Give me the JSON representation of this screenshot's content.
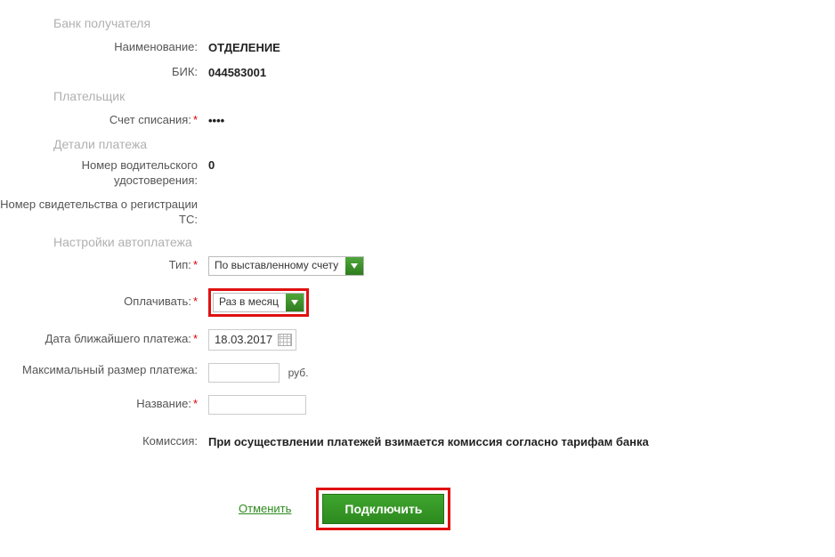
{
  "sections": {
    "recipient_bank": "Банк получателя",
    "payer": "Плательщик",
    "payment_details": "Детали платежа",
    "autopay_settings": "Настройки автоплатежа"
  },
  "labels": {
    "name": "Наименование:",
    "bik": "БИК:",
    "debit_account": "Счет списания:",
    "license_number": "Номер водительского удостоверения:",
    "reg_cert_number": "Номер свидетельства о регистрации ТС:",
    "type": "Тип:",
    "pay": "Оплачивать:",
    "next_date": "Дата ближайшего платежа:",
    "max_amount": "Максимальный размер платежа:",
    "title": "Название:",
    "commission": "Комиссия:"
  },
  "values": {
    "name": "ОТДЕЛЕНИЕ",
    "bik": "044583001",
    "debit_account": "••••",
    "license_number": "0",
    "reg_cert_number": "",
    "type_selected": "По выставленному счету",
    "pay_selected": "Раз в месяц",
    "next_date": "18.03.2017",
    "max_amount": "",
    "currency_unit": "руб.",
    "title": "",
    "commission": "При осуществлении платежей взимается комиссия согласно тарифам банка"
  },
  "actions": {
    "cancel": "Отменить",
    "submit": "Подключить"
  }
}
